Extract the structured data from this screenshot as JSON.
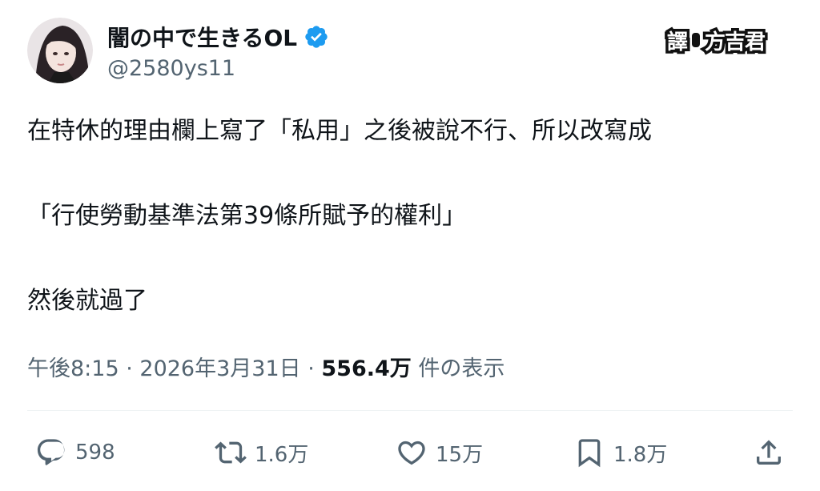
{
  "user": {
    "display_name": "闇の中で生きるOL",
    "handle": "@2580ys11",
    "verified_icon": "verified-badge-icon",
    "avatar_icon": "avatar-photo"
  },
  "watermark": {
    "left": "譯",
    "right": "方吉君"
  },
  "tweet": {
    "lines": [
      "在特休的理由欄上寫了「私用」之後被說不行、所以改寫成",
      "「行使勞動基準法第39條所賦予的權利」",
      "然後就過了"
    ]
  },
  "meta": {
    "time": "午後8:15",
    "separator": " · ",
    "date": "2026年3月31日",
    "views_count": "556.4万",
    "views_label": " 件の表示"
  },
  "actions": {
    "reply": {
      "icon": "reply-icon",
      "count": "598"
    },
    "retweet": {
      "icon": "retweet-icon",
      "count": "1.6万"
    },
    "like": {
      "icon": "heart-icon",
      "count": "15万"
    },
    "bookmark": {
      "icon": "bookmark-icon",
      "count": "1.8万"
    },
    "share": {
      "icon": "share-icon"
    }
  },
  "colors": {
    "text": "#0f1419",
    "secondary": "#536471",
    "verified": "#1d9bf0",
    "divider": "#eff3f4"
  }
}
